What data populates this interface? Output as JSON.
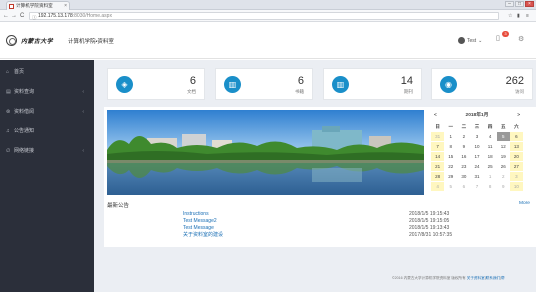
{
  "browser": {
    "tab_title": "计算机学院资料室",
    "tab_close": "×",
    "url_host": "192.175.13.178",
    "url_path": ":8030/Home.aspx",
    "back": "←",
    "forward": "→",
    "reload": "C",
    "menu_icons": {
      "star": "☆",
      "extension": "▮",
      "menu": "≡"
    },
    "win_min": "–",
    "win_max": "□",
    "win_close": "×"
  },
  "header": {
    "brand": "内蒙古大学",
    "dept": "计算机学院•资料室",
    "user_name": "Test",
    "notification_count": "3"
  },
  "sidebar": {
    "items": [
      {
        "icon": "⌂",
        "label": "首页",
        "has_arrow": false
      },
      {
        "icon": "▤",
        "label": "资料查询",
        "has_arrow": true
      },
      {
        "icon": "⊜",
        "label": "资料借阅",
        "has_arrow": true
      },
      {
        "icon": "♫",
        "label": "公告通知",
        "has_arrow": false
      },
      {
        "icon": "∅",
        "label": "网络链接",
        "has_arrow": true
      }
    ],
    "arrow": "‹"
  },
  "stats": [
    {
      "icon": "◈",
      "value": "6",
      "label": "文档"
    },
    {
      "icon": "▥",
      "value": "6",
      "label": "书籍"
    },
    {
      "icon": "▥",
      "value": "14",
      "label": "期刊"
    },
    {
      "icon": "◉",
      "value": "262",
      "label": "访问"
    }
  ],
  "calendar": {
    "title": "2018年1月",
    "prev": "<",
    "next": ">",
    "weekdays": [
      "日",
      "一",
      "二",
      "三",
      "四",
      "五",
      "六"
    ],
    "weeks": [
      [
        "31",
        "1",
        "2",
        "3",
        "4",
        "5",
        "6"
      ],
      [
        "7",
        "8",
        "9",
        "10",
        "11",
        "12",
        "13"
      ],
      [
        "14",
        "15",
        "16",
        "17",
        "18",
        "19",
        "20"
      ],
      [
        "21",
        "22",
        "23",
        "24",
        "25",
        "26",
        "27"
      ],
      [
        "28",
        "29",
        "30",
        "31",
        "1",
        "2",
        "3"
      ],
      [
        "4",
        "5",
        "6",
        "7",
        "8",
        "9",
        "10"
      ]
    ],
    "today": "5"
  },
  "news": {
    "title": "最新公告",
    "more": "More",
    "items": [
      {
        "title": "Instructions",
        "date": "2018/1/5 19:15:43"
      },
      {
        "title": "Test Message2",
        "date": "2018/1/5 19:15:05"
      },
      {
        "title": "Test Message",
        "date": "2018/1/5 19:13:43"
      },
      {
        "title": "关于资料室的建设",
        "date": "2017/8/31 10:57:35"
      }
    ]
  },
  "footer": {
    "copyright": "©2016 内蒙古大学计算机学院资料室 版权所有",
    "link1": "关于资料室",
    "link2": "联系我们",
    "link3": "帮"
  }
}
